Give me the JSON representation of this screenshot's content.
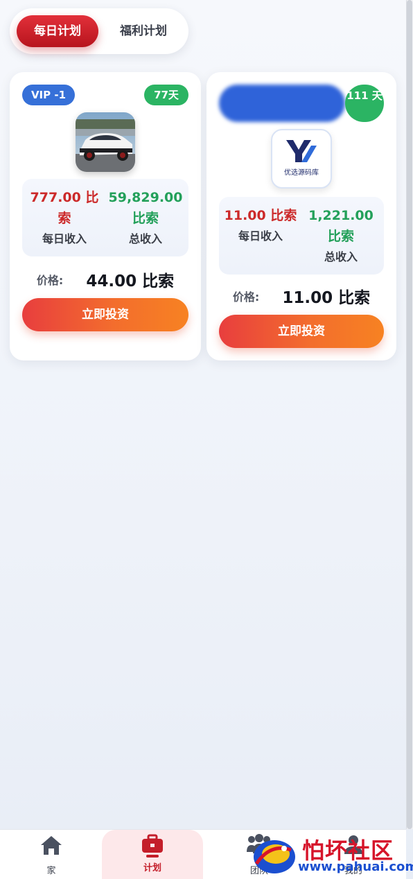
{
  "tabs": [
    {
      "label": "每日计划",
      "active": true
    },
    {
      "label": "福利计划",
      "active": false
    }
  ],
  "plans": [
    {
      "vip": "VIP -1",
      "days": "77天",
      "daily_value": "777.00 比索",
      "daily_label": "每日收入",
      "total_value": "59,829.00 比索",
      "total_label": "总收入",
      "price_label": "价格:",
      "price_value": "44.00 比索",
      "button": "立即投资"
    },
    {
      "days": "111 天",
      "logo_caption": "优选源码库",
      "daily_value": "11.00 比索",
      "daily_label": "每日收入",
      "total_value": "1,221.00 比索",
      "total_label": "总收入",
      "price_label": "价格:",
      "price_value": "11.00 比索",
      "button": "立即投资"
    }
  ],
  "nav": [
    {
      "label": "家",
      "icon": "home-icon"
    },
    {
      "label": "计划",
      "icon": "briefcase-icon",
      "active": true
    },
    {
      "label": "团队",
      "icon": "team-icon"
    },
    {
      "label": "我的",
      "icon": "user-icon"
    }
  ],
  "watermark": {
    "text1": "怕坏社区",
    "text2": "www.pahuai.com"
  },
  "colors": {
    "primary_red": "#c41e2a",
    "accent_orange": "#f78222",
    "vip_blue": "#3670d8",
    "days_green": "#2bb463"
  }
}
